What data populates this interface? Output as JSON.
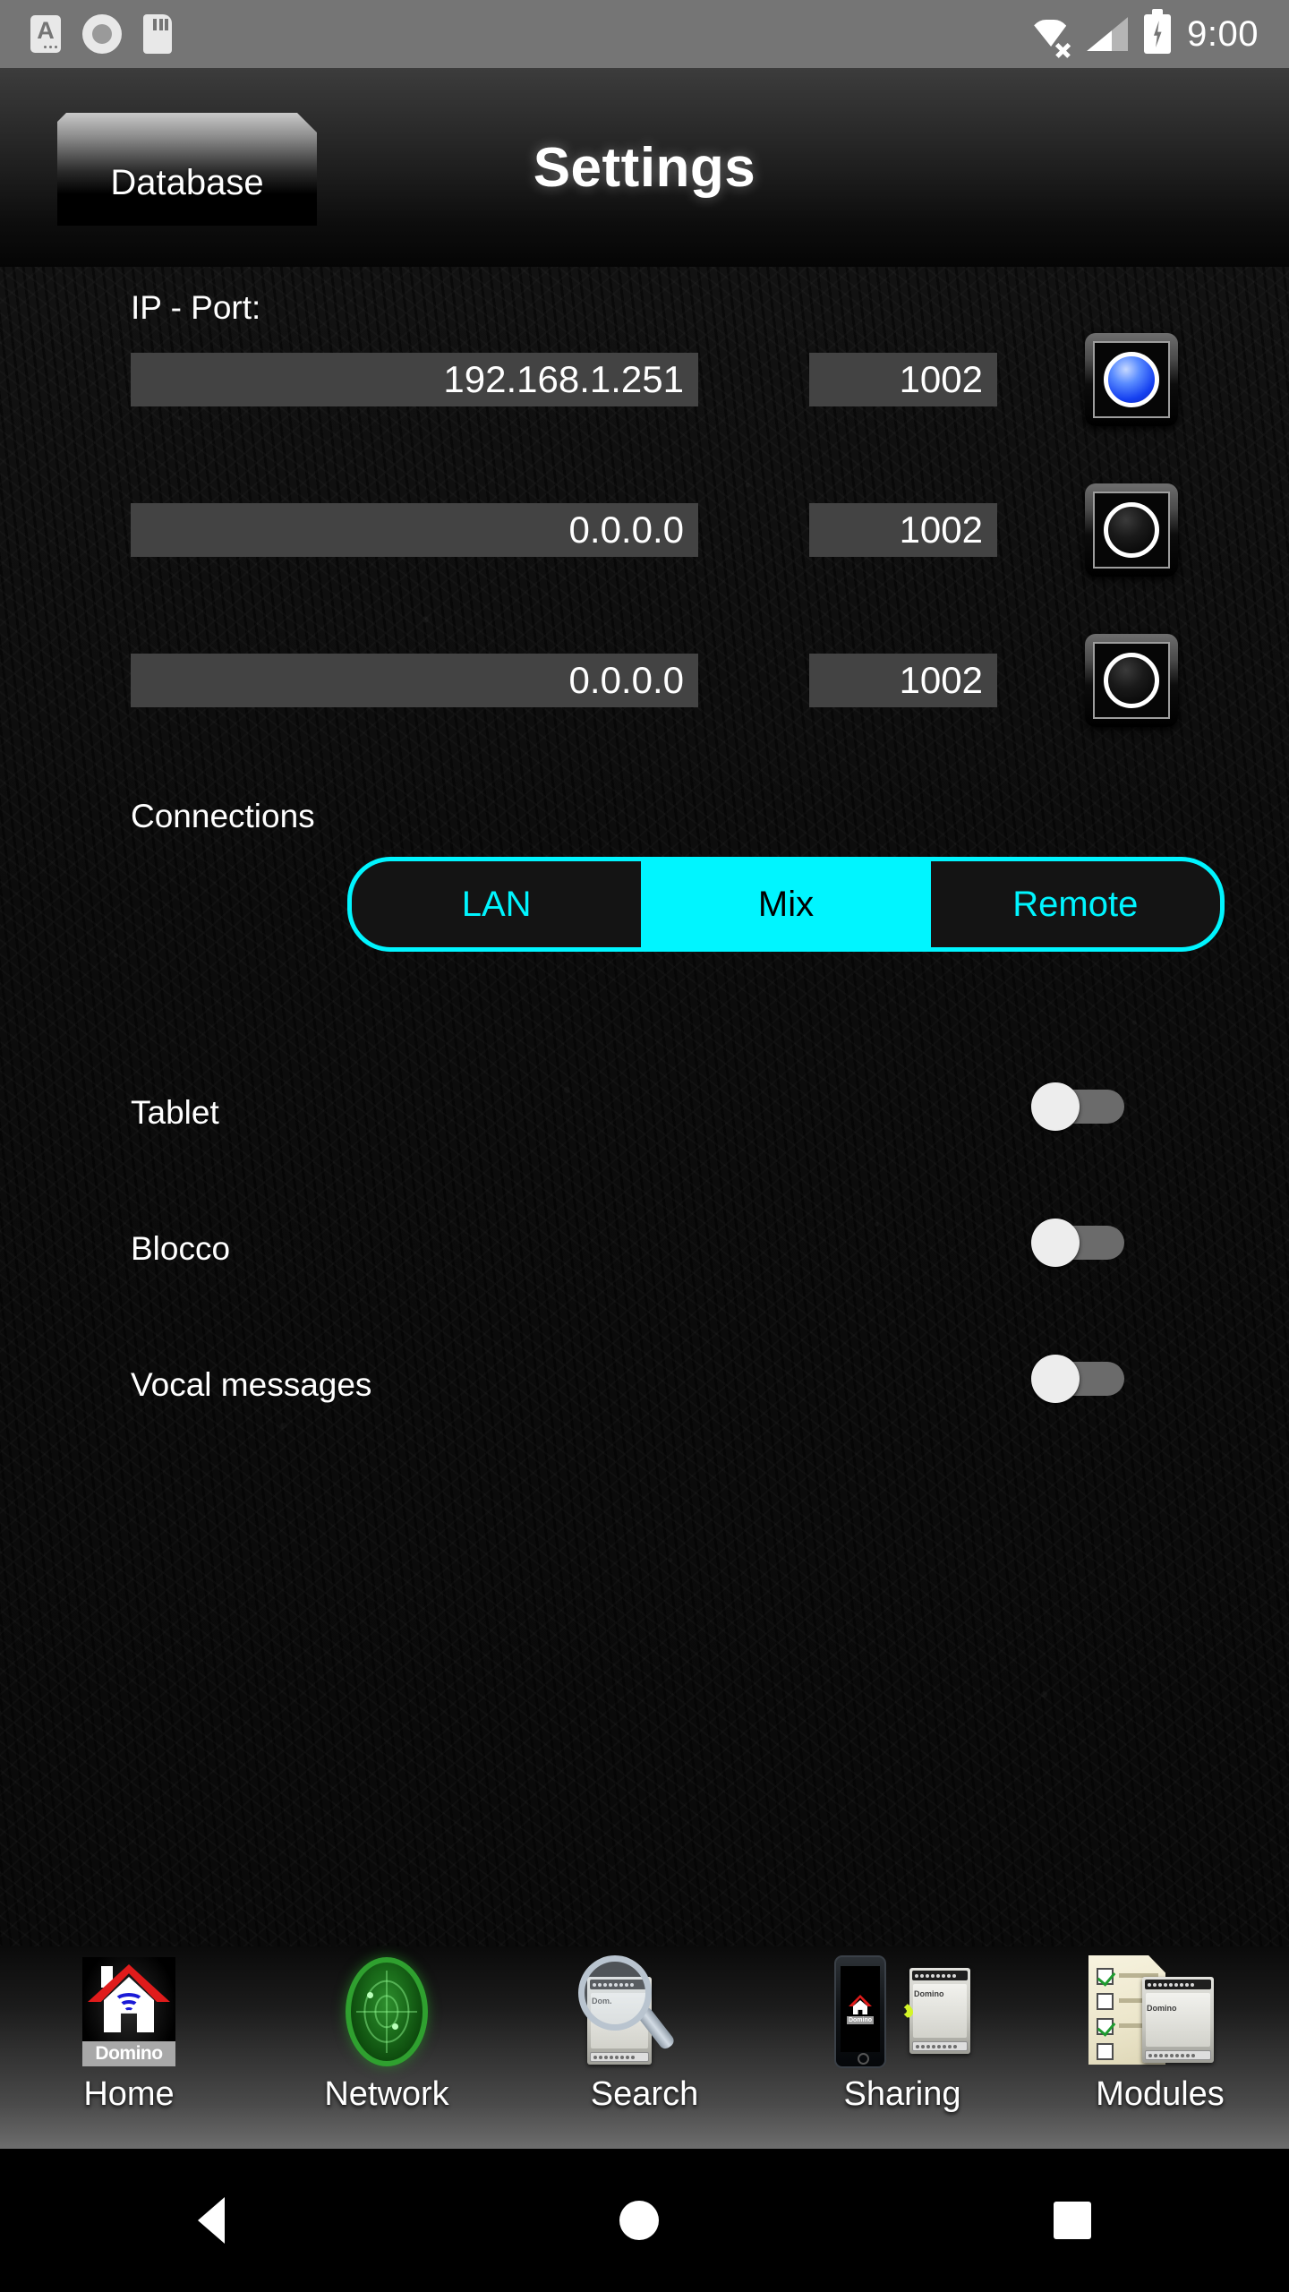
{
  "statusbar": {
    "clock": "9:00",
    "left_icons": [
      "a-card-icon",
      "ring-icon",
      "sim-card-icon"
    ],
    "right_icons": [
      "wifi-off-icon",
      "cellular-signal-icon",
      "battery-charging-icon"
    ]
  },
  "header": {
    "tab_label": "Database",
    "title": "Settings"
  },
  "main": {
    "ip_port_label": "IP - Port:",
    "connections_label": "Connections",
    "rows": [
      {
        "ip": "192.168.1.251",
        "port": "1002",
        "selected": true
      },
      {
        "ip": "0.0.0.0",
        "port": "1002",
        "selected": false
      },
      {
        "ip": "0.0.0.0",
        "port": "1002",
        "selected": false
      }
    ],
    "connections": {
      "options": [
        "LAN",
        "Mix",
        "Remote"
      ],
      "selected": "Mix"
    },
    "toggles": [
      {
        "label": "Tablet",
        "on": false
      },
      {
        "label": "Blocco",
        "on": false
      },
      {
        "label": "Vocal messages",
        "on": false
      }
    ]
  },
  "bottomnav": {
    "items": [
      {
        "label": "Home",
        "icon": "domino-house-icon"
      },
      {
        "label": "Network",
        "icon": "radar-icon"
      },
      {
        "label": "Search",
        "icon": "magnifier-module-icon"
      },
      {
        "label": "Sharing",
        "icon": "phone-wifi-module-icon"
      },
      {
        "label": "Modules",
        "icon": "checklist-module-icon"
      }
    ]
  },
  "androidnav": {
    "buttons": [
      "back-button",
      "home-button",
      "recents-button"
    ]
  },
  "colors": {
    "accent_cyan": "#00f5ff",
    "active_radio_blue": "#1540f0",
    "field_bg": "#434343",
    "statusbar_bg": "#757575"
  }
}
